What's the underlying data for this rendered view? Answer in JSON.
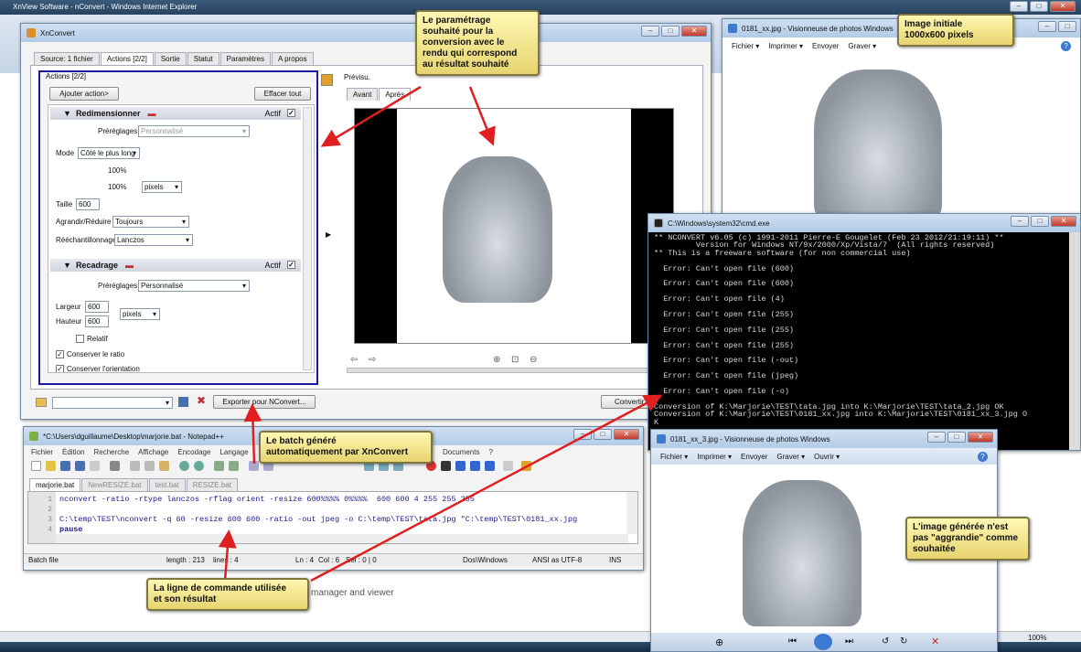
{
  "ie": {
    "title": "XnView Software - nConvert - Windows Internet Explorer",
    "bg_text": "manager and viewer",
    "zoom": "100%"
  },
  "xnconvert": {
    "title": "XnConvert",
    "tabs": [
      "Source: 1 fichier",
      "Actions [2/2]",
      "Sortie",
      "Statut",
      "Paramètres",
      "A propos"
    ],
    "actions_label": "Actions [2/2]",
    "add_action": "Ajouter action>",
    "clear_all": "Effacer tout",
    "resize": {
      "title": "Redimensionner",
      "active": "Actif",
      "presets_label": "Préréglages",
      "presets_value": "Personnalisé",
      "mode_label": "Mode",
      "mode_value": "Côté le plus long",
      "pct1": "100%",
      "pct2": "100%",
      "unit": "pixels",
      "size_label": "Taille",
      "size_value": "600",
      "enlarge_label": "Agrandir/Réduire",
      "enlarge_value": "Toujours",
      "resample_label": "Rééchantillonnage",
      "resample_value": "Lanczos"
    },
    "crop": {
      "title": "Recadrage",
      "active": "Actif",
      "presets_label": "Préréglages",
      "presets_value": "Personnalisé",
      "width_label": "Largeur",
      "width_value": "600",
      "height_label": "Hauteur",
      "height_value": "600",
      "unit": "pixels",
      "relative": "Relatif",
      "keep_ratio": "Conserver le ratio",
      "keep_orientation": "Conserver l'orientation"
    },
    "preview_label": "Prévisu.",
    "before_tab": "Avant",
    "after_tab": "Après",
    "export_button": "Exporter pour NConvert...",
    "convert_button": "Convertir"
  },
  "viewer1": {
    "title": "0181_xx.jpg - Visionneuse de photos Windows",
    "menu": [
      "Fichier ▾",
      "Imprimer ▾",
      "Envoyer",
      "Graver ▾"
    ]
  },
  "viewer2": {
    "title": "0181_xx_3.jpg - Visionneuse de photos Windows",
    "menu": [
      "Fichier ▾",
      "Imprimer ▾",
      "Envoyer",
      "Graver ▾",
      "Ouvrir ▾"
    ]
  },
  "cmd": {
    "title": "C:\\Windows\\system32\\cmd.exe",
    "lines": [
      "** NCONVERT v6.05 (c) 1991-2011 Pierre-E Gougelet (Feb 23 2012/21:19:11) **",
      "         Version for Windows NT/9x/2000/Xp/Vista/7  (All rights reserved)",
      "** This is a freeware software (for non commercial use)",
      "",
      "  Error: Can't open file (600)",
      "",
      "  Error: Can't open file (600)",
      "",
      "  Error: Can't open file (4)",
      "",
      "  Error: Can't open file (255)",
      "",
      "  Error: Can't open file (255)",
      "",
      "  Error: Can't open file (255)",
      "",
      "  Error: Can't open file (-out)",
      "",
      "  Error: Can't open file (jpeg)",
      "",
      "  Error: Can't open file (-o)",
      "",
      "Conversion of K:\\Marjorie\\TEST\\tata.jpg into K:\\Marjorie\\TEST\\tata_2.jpg OK",
      "Conversion of K:\\Marjorie\\TEST\\0181_xx.jpg into K:\\Marjorie\\TEST\\0181_xx_3.jpg O",
      "K"
    ]
  },
  "notepad": {
    "title": "*C:\\Users\\dguillaume\\Desktop\\marjorie.bat - Notepad++",
    "menu": [
      "Fichier",
      "Édition",
      "Recherche",
      "Affichage",
      "Encodage",
      "Langage"
    ],
    "menu_right": [
      "Documents",
      "?"
    ],
    "tabs": [
      "marjorie.bat",
      "NewRESIZE.bat",
      "test.bat",
      "RESIZE.bat"
    ],
    "line_numbers": [
      "1",
      "2",
      "3",
      "4"
    ],
    "code": [
      "nconvert -ratio -rtype lanczos -rflag orient -resize 600%%%% 0%%%%  600 600 4 255 255 255",
      "",
      "C:\\temp\\TEST\\nconvert -q 60 -resize 600 600 -ratio -out jpeg -o C:\\temp\\TEST\\tata.jpg \"C:\\temp\\TEST\\0181_xx.jpg",
      "pause"
    ],
    "status": [
      "Batch file",
      "length : 213",
      "lines : 4",
      "Ln : 4",
      "Col : 6",
      "Sel : 0 | 0",
      "Dos\\Windows",
      "ANSI as UTF-8",
      "INS"
    ]
  },
  "notes": {
    "n1": "Le paramétrage\nsouhaité pour la\nconversion avec le\nrendu qui correspond\nau résultat souhaité",
    "n2": "Image initiale\n1000x600 pixels",
    "n3": "Le batch généré\nautomatiquement par XnConvert",
    "n4": "La ligne de commande utilisée\net son résultat",
    "n5": "L'image générée n'est\npas \"aggrandie\" comme\nsouhaitée"
  },
  "colors": {
    "annotation_arrow": "#e02020",
    "note_bg": "#f3e58a",
    "highlight_border": "#1a1aa0",
    "cmd_bg": "#000000"
  }
}
